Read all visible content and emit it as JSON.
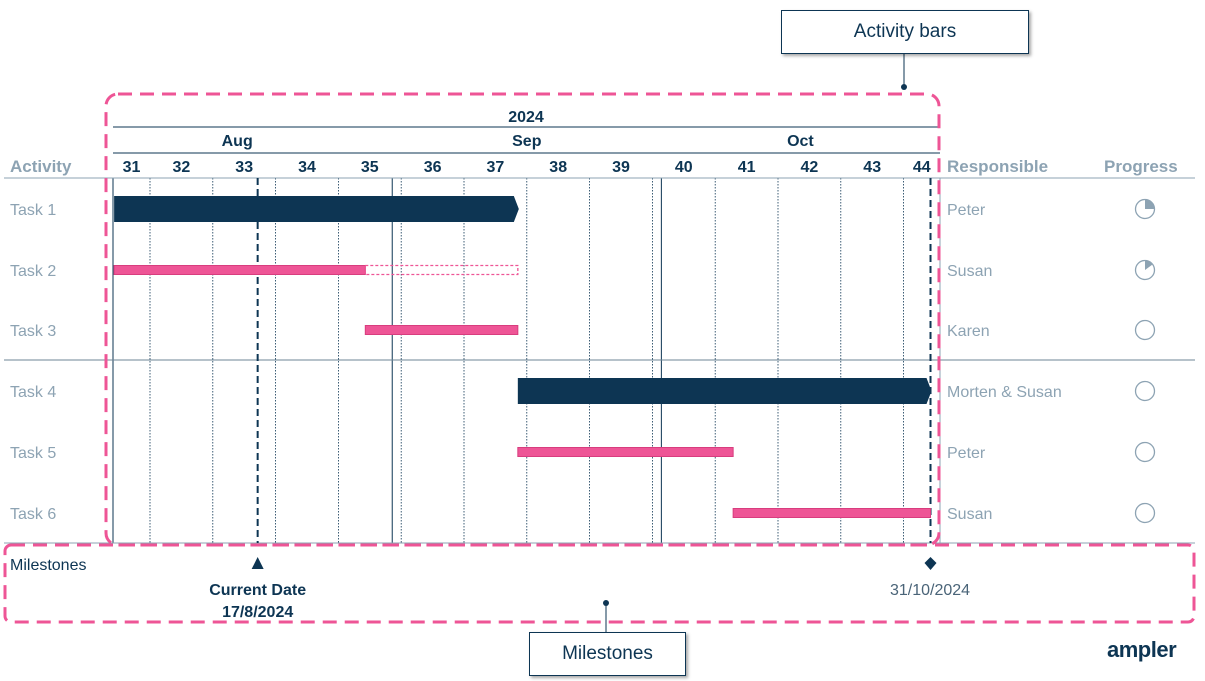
{
  "year": "2024",
  "months": [
    {
      "label": "Aug",
      "start": "2024-08-01",
      "end": "2024-08-31"
    },
    {
      "label": "Sep",
      "start": "2024-09-01",
      "end": "2024-09-30"
    },
    {
      "label": "Oct",
      "start": "2024-10-01",
      "end": "2024-10-31"
    }
  ],
  "weeks": [
    "31",
    "32",
    "33",
    "34",
    "35",
    "36",
    "37",
    "38",
    "39",
    "40",
    "41",
    "42",
    "43",
    "44"
  ],
  "headers": {
    "activity": "Activity",
    "responsible": "Responsible",
    "progress": "Progress"
  },
  "tasks": [
    {
      "name": "Task 1",
      "responsible": "Peter",
      "type": "summary",
      "start": "2024-08-01",
      "end": "2024-09-15",
      "progress": 0.25
    },
    {
      "name": "Task 2",
      "responsible": "Susan",
      "type": "task",
      "start": "2024-08-01",
      "end": "2024-09-15",
      "done_until": "2024-08-29",
      "progress": 0.15
    },
    {
      "name": "Task 3",
      "responsible": "Karen",
      "type": "task",
      "start": "2024-08-29",
      "end": "2024-09-15",
      "progress": 0
    },
    {
      "name": "Task 4",
      "responsible": "Morten & Susan",
      "type": "summary",
      "start": "2024-09-15",
      "end": "2024-10-31",
      "progress": 0
    },
    {
      "name": "Task 5",
      "responsible": "Peter",
      "type": "task",
      "start": "2024-09-15",
      "end": "2024-10-09",
      "progress": 0
    },
    {
      "name": "Task 6",
      "responsible": "Susan",
      "type": "task",
      "start": "2024-10-09",
      "end": "2024-10-31",
      "progress": 0
    }
  ],
  "milestones": {
    "label": "Milestones",
    "current": {
      "title": "Current Date",
      "date_label": "17/8/2024",
      "date": "2024-08-17"
    },
    "end": {
      "date_label": "31/10/2024",
      "date": "2024-10-31"
    }
  },
  "callouts": {
    "activity_bars": "Activity bars",
    "milestones": "Milestones"
  },
  "logo": "ampler",
  "colors": {
    "dark": "#0d3553",
    "pink": "#ee5596",
    "muted": "#8da3b3"
  }
}
